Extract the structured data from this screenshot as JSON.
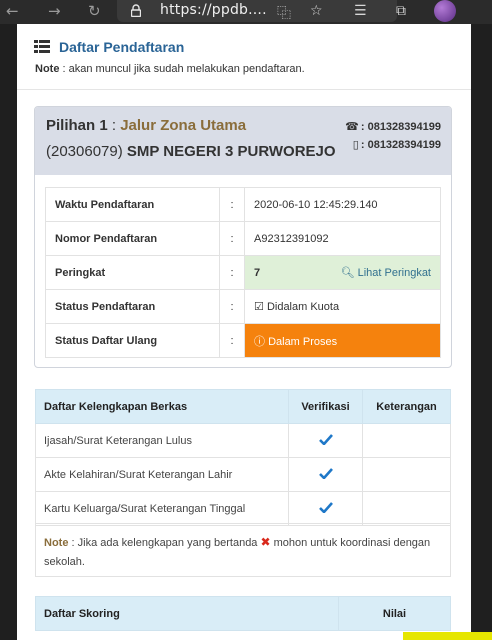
{
  "browser": {
    "url": "https://ppdb....",
    "nav_back": "←",
    "nav_forward": "→",
    "reload": "↻"
  },
  "header": {
    "title": "Daftar Pendaftaran",
    "note_label": "Note",
    "note_text": " : akan muncul jika sudah melakukan pendaftaran."
  },
  "choice": {
    "label": "Pilihan 1",
    "separator": " : ",
    "path": "Jalur Zona Utama",
    "school_code": "(20306079)",
    "school_name": " SMP NEGERI 3 PURWOREJO",
    "phone1": ": 081328394199",
    "phone2": ": 081328394199",
    "rows": [
      {
        "label": "Waktu Pendaftaran",
        "colon": ":",
        "value": "2020-06-10 12:45:29.140"
      },
      {
        "label": "Nomor Pendaftaran",
        "colon": ":",
        "value": "A92312391092"
      },
      {
        "label": "Peringkat",
        "colon": ":",
        "value": "7",
        "action": "Lihat Peringkat"
      },
      {
        "label": "Status Pendaftaran",
        "colon": ":",
        "value": "Didalam Kuota"
      },
      {
        "label": "Status Daftar Ulang",
        "colon": ":",
        "value": "Dalam Proses"
      }
    ]
  },
  "berkas": {
    "headers": [
      "Daftar Kelengkapan Berkas",
      "Verifikasi",
      "Keterangan"
    ],
    "rows": [
      {
        "name": "Ijasah/Surat Keterangan Lulus",
        "verified": true,
        "note": ""
      },
      {
        "name": "Akte Kelahiran/Surat Keterangan Lahir",
        "verified": true,
        "note": ""
      },
      {
        "name": "Kartu Keluarga/Surat Keterangan Tinggal",
        "verified": true,
        "note": ""
      }
    ],
    "note_label": "Note",
    "note_text_a": " : Jika ada kelengkapan yang bertanda ",
    "note_text_b": " mohon untuk koordinasi dengan sekolah."
  },
  "skoring": {
    "headers": [
      "Daftar Skoring",
      "Nilai"
    ]
  },
  "colors": {
    "accent_blue": "#2a6496",
    "gold": "#8a6d3b",
    "status_orange": "#f5820d",
    "rank_green": "#dff0d8",
    "table_head": "#d9edf7",
    "check_blue": "#1f78c8",
    "x_red": "#d9291c"
  }
}
